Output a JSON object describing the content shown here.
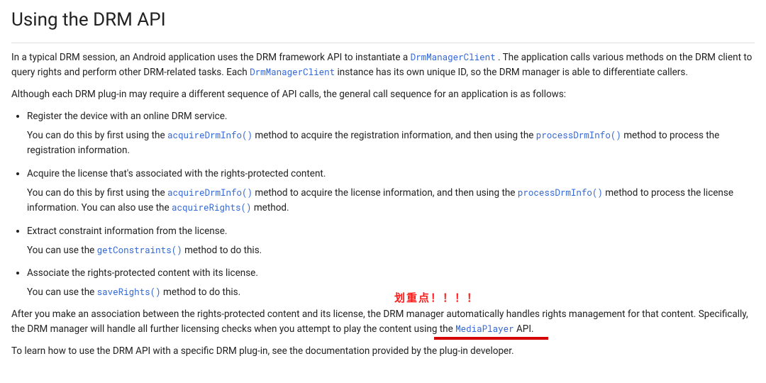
{
  "heading": "Using the DRM API",
  "intro": {
    "p1a": "In a typical DRM session, an Android application uses the DRM framework API to instantiate a ",
    "p1_code1": "DrmManagerClient",
    "p1b": ". The application calls various methods on the DRM client to query rights and perform other DRM-related tasks. Each ",
    "p1_code2": "DrmManagerClient",
    "p1c": " instance has its own unique ID, so the DRM manager is able to differentiate callers.",
    "p2": "Although each DRM plug-in may require a different sequence of API calls, the general call sequence for an application is as follows:"
  },
  "steps": [
    {
      "head": "Register the device with an online DRM service.",
      "body_a": "You can do this by first using the ",
      "code1": "acquireDrmInfo()",
      "body_b": " method to acquire the registration information, and then using the ",
      "code2": "processDrmInfo()",
      "body_c": " method to process the registration information."
    },
    {
      "head": "Acquire the license that's associated with the rights-protected content.",
      "body_a": "You can do this by first using the ",
      "code1": "acquireDrmInfo()",
      "body_b": " method to acquire the license information, and then using the ",
      "code2": "processDrmInfo()",
      "body_c": " method to process the license information. You can also use the ",
      "code3": "acquireRights()",
      "body_d": " method."
    },
    {
      "head": "Extract constraint information from the license.",
      "body_a": "You can use the ",
      "code1": "getConstraints()",
      "body_b": " method to do this."
    },
    {
      "head": "Associate the rights-protected content with its license.",
      "body_a": "You can use the ",
      "code1": "saveRights()",
      "body_b": " method to do this."
    }
  ],
  "annotation": "划重点！！！！",
  "outro": {
    "p1a": "After you make an association between the rights-protected content and its license, the DRM manager automatically handles rights management for that content. Specifically, the DRM manager will handle all further licensing checks when you attempt to play the content using the ",
    "p1_code": "MediaPlayer",
    "p1b": " API.",
    "p2": "To learn how to use the DRM API with a specific DRM plug-in, see the documentation provided by the plug-in developer."
  }
}
